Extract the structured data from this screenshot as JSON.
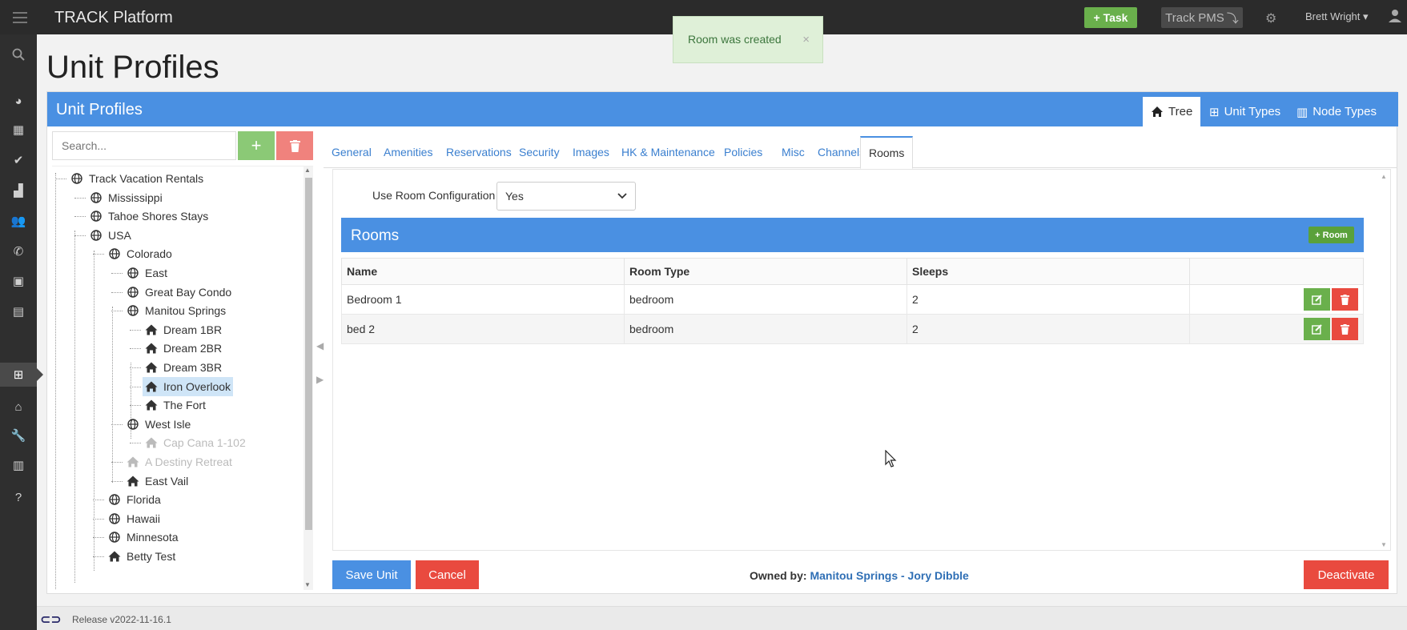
{
  "app": {
    "title": "TRACK Platform",
    "task_label": "Task",
    "pms_label": "Track PMS",
    "user_name": "Brett Wright"
  },
  "toast": {
    "message": "Room was created",
    "close": "×"
  },
  "page": {
    "title": "Unit Profiles"
  },
  "panel": {
    "title": "Unit Profiles",
    "view_tabs": [
      {
        "label": "Tree",
        "icon": "home-icon",
        "active": true
      },
      {
        "label": "Unit Types",
        "icon": "grid-icon",
        "active": false
      },
      {
        "label": "Node Types",
        "icon": "map-icon",
        "active": false
      }
    ]
  },
  "tree": {
    "search_placeholder": "Search...",
    "nodes": [
      {
        "label": "Track Vacation Rentals",
        "type": "globe",
        "depth": 0,
        "state": "normal"
      },
      {
        "label": "Mississippi",
        "type": "globe",
        "depth": 1,
        "state": "normal"
      },
      {
        "label": "Tahoe Shores Stays",
        "type": "globe",
        "depth": 1,
        "state": "normal"
      },
      {
        "label": "USA",
        "type": "globe",
        "depth": 1,
        "state": "normal"
      },
      {
        "label": "Colorado",
        "type": "globe",
        "depth": 2,
        "state": "normal"
      },
      {
        "label": "East",
        "type": "globe",
        "depth": 3,
        "state": "normal"
      },
      {
        "label": "Great Bay Condo",
        "type": "globe",
        "depth": 3,
        "state": "normal"
      },
      {
        "label": "Manitou Springs",
        "type": "globe",
        "depth": 3,
        "state": "normal"
      },
      {
        "label": "Dream 1BR",
        "type": "home",
        "depth": 4,
        "state": "normal"
      },
      {
        "label": "Dream 2BR",
        "type": "home",
        "depth": 4,
        "state": "normal"
      },
      {
        "label": "Dream 3BR",
        "type": "home",
        "depth": 4,
        "state": "normal"
      },
      {
        "label": "Iron Overlook",
        "type": "home",
        "depth": 4,
        "state": "selected"
      },
      {
        "label": "The Fort",
        "type": "home",
        "depth": 4,
        "state": "normal"
      },
      {
        "label": "West Isle",
        "type": "globe",
        "depth": 3,
        "state": "normal"
      },
      {
        "label": "Cap Cana 1-102",
        "type": "home",
        "depth": 4,
        "state": "dim"
      },
      {
        "label": "A Destiny Retreat",
        "type": "home",
        "depth": 3,
        "state": "dim"
      },
      {
        "label": "East Vail",
        "type": "home",
        "depth": 3,
        "state": "normal"
      },
      {
        "label": "Florida",
        "type": "globe",
        "depth": 2,
        "state": "normal"
      },
      {
        "label": "Hawaii",
        "type": "globe",
        "depth": 2,
        "state": "normal"
      },
      {
        "label": "Minnesota",
        "type": "globe",
        "depth": 2,
        "state": "normal"
      },
      {
        "label": "Betty Test",
        "type": "home",
        "depth": 2,
        "state": "normal"
      }
    ]
  },
  "tabs": [
    "General",
    "Amenities",
    "Reservations",
    "Security",
    "Images",
    "HK & Maintenance",
    "Policies",
    "Misc",
    "Channels",
    "Rooms"
  ],
  "active_tab": "Rooms",
  "rooms": {
    "config_label": "Use Room Configuration",
    "config_value": "Yes",
    "header": "Rooms",
    "add_label": "Room",
    "columns": [
      "Name",
      "Room Type",
      "Sleeps"
    ],
    "rows": [
      {
        "name": "Bedroom 1",
        "type": "bedroom",
        "sleeps": "2"
      },
      {
        "name": "bed 2",
        "type": "bedroom",
        "sleeps": "2"
      }
    ]
  },
  "actions": {
    "save": "Save Unit",
    "cancel": "Cancel",
    "owned_label": "Owned by:",
    "owned_value": "Manitou Springs - Jory Dibble",
    "deactivate": "Deactivate"
  },
  "footer": {
    "release": "Release v2022-11-16.1"
  },
  "colors": {
    "primary": "#4a90e2",
    "success": "#6ab04c",
    "danger": "#e94a3f",
    "topbar": "#2b2b2b"
  }
}
